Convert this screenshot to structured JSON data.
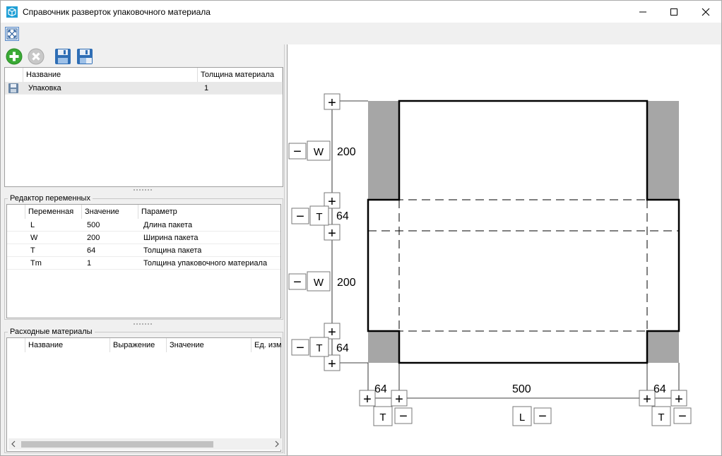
{
  "window": {
    "title": "Справочник разверток упаковочного материала",
    "icons": {
      "app": "box-cube-icon",
      "minimize": "minimize-icon",
      "maximize": "maximize-icon",
      "close": "close-icon"
    }
  },
  "toolbar": {
    "fit_icon": "zoom-fit-icon",
    "add_icon": "add-icon",
    "delete_icon": "delete-icon",
    "save_icon": "save-icon",
    "save_as_icon": "save-as-icon"
  },
  "packages": {
    "columns": [
      "Название",
      "Толщина материала"
    ],
    "rows": [
      {
        "name": "Упаковка",
        "thickness": "1"
      }
    ]
  },
  "variables": {
    "label": "Редактор переменных",
    "columns": [
      "Переменная",
      "Значение",
      "Параметр"
    ],
    "rows": [
      {
        "var": "L",
        "value": "500",
        "param": "Длина пакета"
      },
      {
        "var": "W",
        "value": "200",
        "param": "Ширина пакета"
      },
      {
        "var": "T",
        "value": "64",
        "param": "Толщина пакета"
      },
      {
        "var": "Tm",
        "value": "1",
        "param": "Толщина упаковочного материала"
      }
    ]
  },
  "consumables": {
    "label": "Расходные материалы",
    "columns": [
      "Название",
      "Выражение",
      "Значение",
      "Ед. изм"
    ],
    "rows": []
  },
  "drawing": {
    "vertical": [
      {
        "var": "W",
        "value": "200"
      },
      {
        "var": "T",
        "value": "64"
      },
      {
        "var": "W",
        "value": "200"
      },
      {
        "var": "T",
        "value": "64"
      }
    ],
    "horizontal": [
      {
        "var": "T",
        "value": "64"
      },
      {
        "var": "L",
        "value": "500"
      },
      {
        "var": "T",
        "value": "64"
      }
    ],
    "plus_symbol": "+",
    "minus_symbol": "−"
  }
}
